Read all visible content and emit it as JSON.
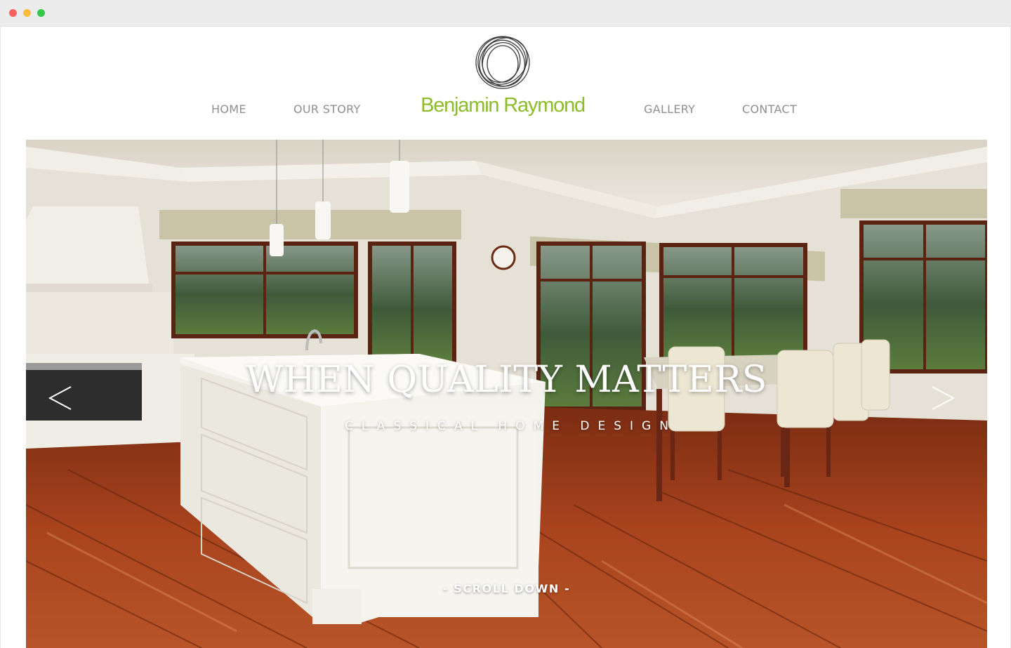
{
  "browser": {
    "window_buttons": [
      "close",
      "minimize",
      "maximize"
    ]
  },
  "header": {
    "logo_icon": "scribble-circle-logo-icon",
    "brand_name": "Benjamin Raymond",
    "nav": {
      "home": "HOME",
      "our_story": "OUR STORY",
      "gallery": "GALLERY",
      "contact": "CONTACT"
    }
  },
  "hero": {
    "title": "WHEN QUALITY MATTERS",
    "subtitle": "CLASSICAL HOME DESIGN",
    "scroll_label": "- SCROLL DOWN -",
    "prev_icon": "chevron-left-icon",
    "next_icon": "chevron-right-icon",
    "image_subject": "kitchen-dining-room-photo"
  },
  "colors": {
    "brand_green": "#8cbd29",
    "nav_gray": "#8f8f8f",
    "floor_wood": "#a8431e",
    "wall_cream": "#e9e4da"
  }
}
